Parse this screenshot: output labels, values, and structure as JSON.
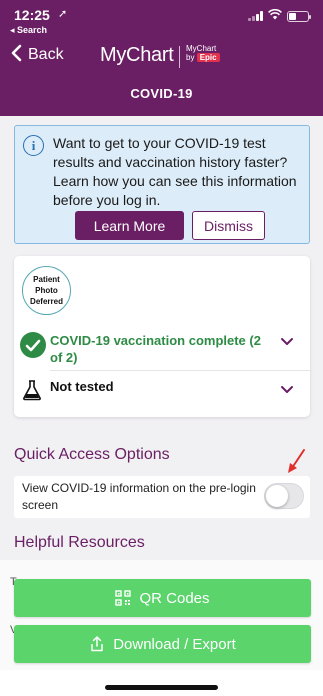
{
  "status_bar": {
    "time": "12:25",
    "back_app": "◂ Search"
  },
  "nav": {
    "back_label": "Back",
    "logo_text": "MyChart",
    "sublogo_line1": "MyChart",
    "sublogo_line2": "by",
    "sublogo_epic": "Epic",
    "title": "COVID-19"
  },
  "banner": {
    "text": "Want to get to your COVID-19 test results and vaccination history faster? Learn how you can see this information before you log in.",
    "learn_more": "Learn More",
    "dismiss": "Dismiss"
  },
  "status_card": {
    "avatar_text": "Patient Photo Deferred",
    "vaccination": "COVID-19 vaccination complete (2 of 2)",
    "testing": "Not tested"
  },
  "quick_access": {
    "title": "Quick Access Options",
    "prelogin_label": "View COVID-19 information on the pre-login screen",
    "prelogin_enabled": false
  },
  "resources": {
    "title": "Helpful Resources",
    "peek_1": "T",
    "peek_2": "V",
    "qr_codes": "QR Codes",
    "download_export": "Download / Export"
  },
  "colors": {
    "brand": "#6a1f64",
    "success": "#2e8b45",
    "action_green": "#5bd46c",
    "info_bg": "#dcecf8"
  }
}
